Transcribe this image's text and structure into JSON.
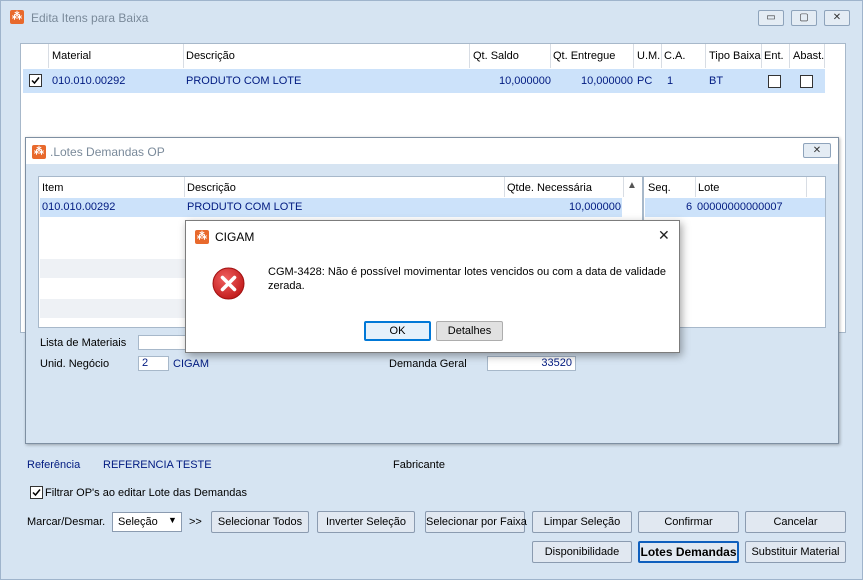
{
  "window": {
    "title": "Edita Itens para Baixa",
    "controls": {
      "minimize": "▭",
      "restore": "▢",
      "close": "✕"
    }
  },
  "items_grid": {
    "headers": [
      "Material",
      "Descrição",
      "Qt. Saldo",
      "Qt. Entregue",
      "U.M.",
      "C.A.",
      "Tipo Baixa",
      "Ent.",
      "Abast."
    ],
    "rows": [
      {
        "checked": true,
        "material": "010.010.00292",
        "descricao": "PRODUTO COM LOTE",
        "qt_saldo": "10,000000",
        "qt_entregue": "10,000000",
        "um": "PC",
        "ca": "1",
        "tipo_baixa": "BT",
        "ent": false,
        "abast": false
      }
    ]
  },
  "lotes_window": {
    "title": ".Lotes Demandas OP",
    "close": "✕",
    "left_grid": {
      "headers": [
        "Item",
        "Descrição",
        "Qtde. Necessária"
      ],
      "rows": [
        {
          "item": "010.010.00292",
          "descricao": "PRODUTO COM LOTE",
          "qtde": "10,000000"
        }
      ]
    },
    "right_grid": {
      "headers": [
        "Seq.",
        "Lote"
      ],
      "rows": [
        {
          "seq": "6",
          "lote": "00000000000007"
        }
      ]
    },
    "lista_materiais_label": "Lista de Materiais",
    "unid_negocio_label": "Unid. Negócio",
    "unid_negocio_code": "2",
    "unid_negocio_name": "CIGAM",
    "demanda_geral_label": "Demanda Geral",
    "demanda_geral_value": "33520"
  },
  "dialog": {
    "title": "CIGAM",
    "message": "CGM-3428: Não é possível movimentar lotes vencidos ou com a data de validade zerada.",
    "ok": "OK",
    "details": "Detalhes",
    "close": "✕"
  },
  "footer": {
    "referencia_label": "Referência",
    "referencia_value": "REFERENCIA TESTE",
    "fabricante_label": "Fabricante",
    "filtrar_label": "Filtrar OP's ao editar Lote das Demandas",
    "filtrar_checked": true,
    "marcar_label": "Marcar/Desmar.",
    "marcar_select": "Seleção",
    "arrows": ">>",
    "buttons": {
      "selecionar_todos": "Selecionar Todos",
      "inverter_selecao": "Inverter Seleção",
      "selecionar_por_faixa": "Selecionar por Faixa",
      "limpar_selecao": "Limpar Seleção",
      "confirmar": "Confirmar",
      "cancelar": "Cancelar",
      "disponibilidade": "Disponibilidade",
      "lotes_demandas": "Lotes Demandas",
      "substituir_material": "Substituir Material"
    }
  }
}
